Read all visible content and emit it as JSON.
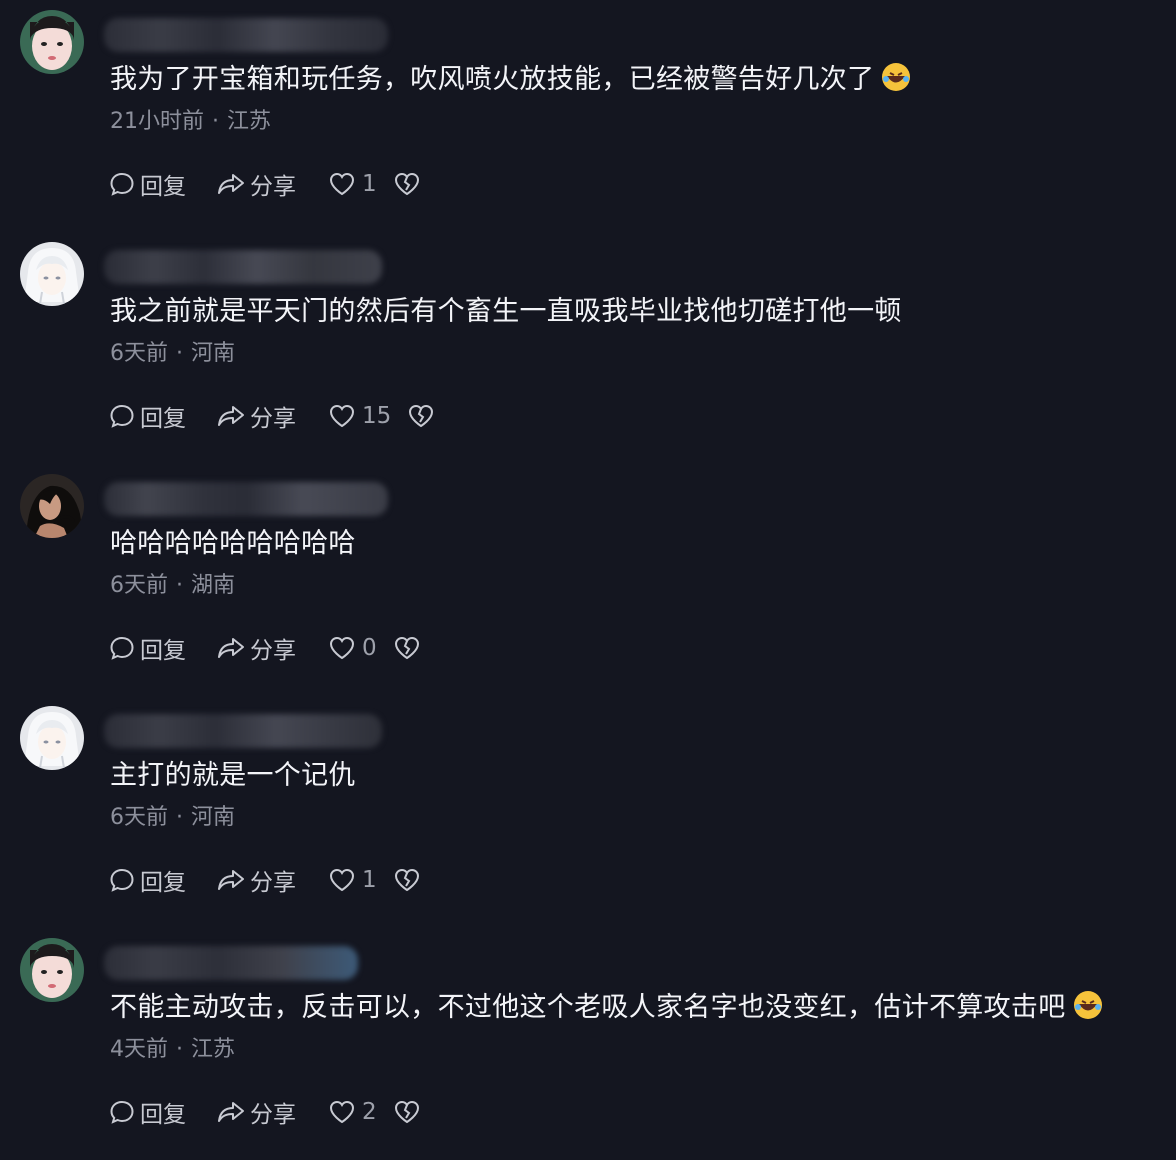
{
  "actions": {
    "reply_label": "回复",
    "share_label": "分享"
  },
  "comments": [
    {
      "text": "我为了开宝箱和玩任务，吹风喷火放技能，已经被警告好几次了",
      "has_emoji": true,
      "time": "21小时前",
      "location": "江苏",
      "likes": "1",
      "avatar_icon": "girl-face-avatar"
    },
    {
      "text": "我之前就是平天门的然后有个畜生一直吸我毕业找他切磋打他一顿",
      "has_emoji": false,
      "time": "6天前",
      "location": "河南",
      "likes": "15",
      "avatar_icon": "white-hair-anime-avatar"
    },
    {
      "text": "哈哈哈哈哈哈哈哈哈",
      "has_emoji": false,
      "time": "6天前",
      "location": "湖南",
      "likes": "0",
      "avatar_icon": "dark-portrait-avatar"
    },
    {
      "text": "主打的就是一个记仇",
      "has_emoji": false,
      "time": "6天前",
      "location": "河南",
      "likes": "1",
      "avatar_icon": "white-hair-anime-avatar"
    },
    {
      "text": "不能主动攻击，反击可以，不过他这个老吸人家名字也没变红，估计不算攻击吧",
      "has_emoji": true,
      "time": "4天前",
      "location": "江苏",
      "likes": "2",
      "avatar_icon": "girl-face-avatar"
    }
  ],
  "meta_separator": "·",
  "colors": {
    "background": "#141620",
    "text": "#f3f4f8",
    "meta": "#8d909c",
    "icon": "#c8cad2"
  }
}
